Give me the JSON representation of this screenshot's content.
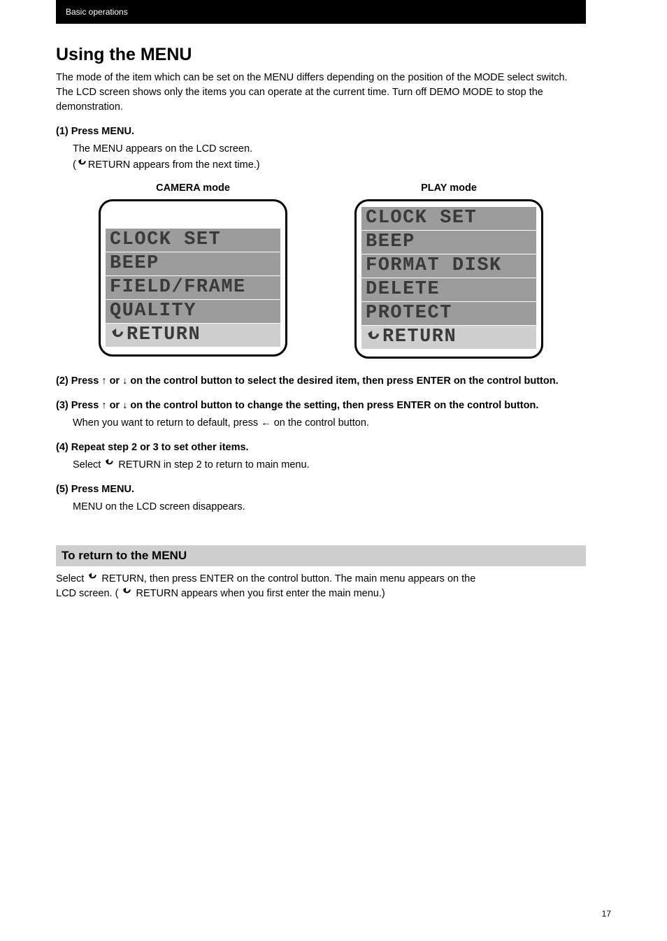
{
  "header": {
    "label": "Basic operations"
  },
  "title": "Using the MENU",
  "intro": "The mode of the item which can be set on the MENU differs depending on the position of the MODE select switch. The LCD screen shows only the items you can operate at the current time. Turn off DEMO MODE to stop the demonstration.",
  "step1": {
    "bold_lead": "(1)",
    "bold_text": "Press MENU.",
    "line2": "The MENU appears on the LCD screen.",
    "line3_prefix": "(",
    "line3_mid": "RETURN appears from the next time.)",
    "line3_return_arrow": true
  },
  "screens": {
    "left": {
      "caption": "CAMERA mode",
      "has_spacer": true,
      "items": [
        "CLOCK SET",
        "BEEP",
        "FIELD/FRAME",
        "QUALITY"
      ],
      "return_label": "RETURN"
    },
    "right": {
      "caption": "PLAY mode",
      "has_spacer": false,
      "items": [
        "CLOCK SET",
        "BEEP",
        "FORMAT DISK",
        "DELETE",
        "PROTECT"
      ],
      "return_label": "RETURN"
    }
  },
  "step2": {
    "bold": "(2) Press  ↑  or  ↓  on the control button to select the desired item, then press ENTER on the control button."
  },
  "step3": {
    "bold": "(3) Press  ↑  or  ↓  on the control button to change the setting, then press ENTER on the control button.",
    "sub": "When you want to return to default, press ← on the control button."
  },
  "step4": {
    "bold": "(4) Repeat step 2 or 3 to set other items.",
    "sub_prefix": "Select ",
    "sub_mid": "RETURN in step 2 to return to main menu."
  },
  "step5": {
    "bold": "(5) Press MENU.",
    "sub": "MENU on the LCD screen disappears."
  },
  "return_section": {
    "heading": "To return to the MENU",
    "body_prefix": "Select ",
    "body_mid1": "RETURN, then press ENTER on the control button. The main menu appears on the",
    "body_line2_prefix": "LCD screen. (",
    "body_line2_mid": "RETURN appears when you first enter the main menu.)"
  },
  "page_number": "17"
}
